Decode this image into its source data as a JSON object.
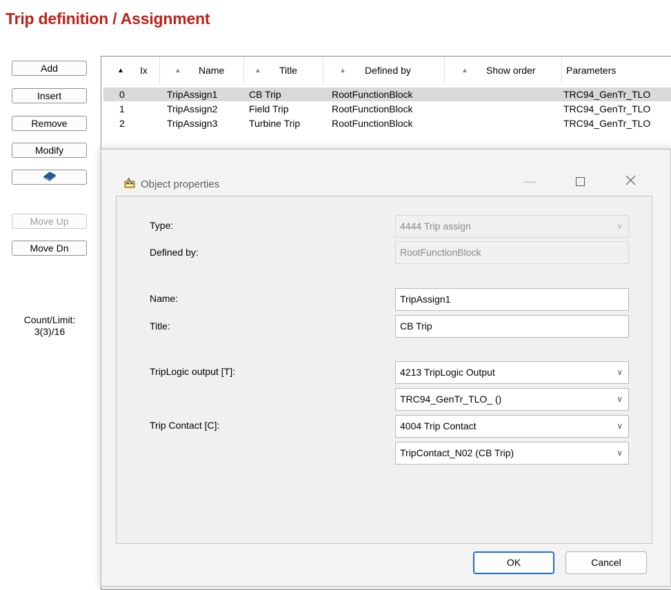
{
  "page": {
    "title": "Trip definition / Assignment"
  },
  "side_buttons": {
    "add": "Add",
    "insert": "Insert",
    "remove": "Remove",
    "modify": "Modify",
    "move_up": "Move Up",
    "move_dn": "Move Dn"
  },
  "count": {
    "label": "Count/Limit:",
    "value": "3(3)/16"
  },
  "table": {
    "columns": [
      "Ix",
      "Name",
      "Title",
      "Defined by",
      "Show order",
      "Parameters"
    ],
    "rows": [
      {
        "ix": "0",
        "name": "TripAssign1",
        "title": "CB Trip",
        "defined_by": "RootFunctionBlock",
        "show_order": "",
        "parameters": "TRC94_GenTr_TLO"
      },
      {
        "ix": "1",
        "name": "TripAssign2",
        "title": "Field Trip",
        "defined_by": "RootFunctionBlock",
        "show_order": "",
        "parameters": "TRC94_GenTr_TLO"
      },
      {
        "ix": "2",
        "name": "TripAssign3",
        "title": "Turbine Trip",
        "defined_by": "RootFunctionBlock",
        "show_order": "",
        "parameters": "TRC94_GenTr_TLO"
      }
    ],
    "selected_row": 0
  },
  "dialog": {
    "title": "Object properties",
    "labels": {
      "type": "Type:",
      "defined_by": "Defined by:",
      "name": "Name:",
      "title": "Title:",
      "triplogic": "TripLogic output [T]:",
      "trip_contact": "Trip Contact [C]:"
    },
    "values": {
      "type": "4444  Trip assign",
      "defined_by": "RootFunctionBlock",
      "name": "TripAssign1",
      "title": "CB Trip",
      "triplogic_type": "4213  TripLogic Output",
      "triplogic_value": "TRC94_GenTr_TLO_ ()",
      "trip_contact_type": "4004  Trip Contact",
      "trip_contact_value": "TripContact_N02 (CB Trip)"
    },
    "buttons": {
      "ok": "OK",
      "cancel": "Cancel"
    }
  },
  "colors": {
    "title_red": "#c0211a",
    "accent_blue": "#1f6fd0",
    "selection_gray": "#d9d9d9"
  }
}
